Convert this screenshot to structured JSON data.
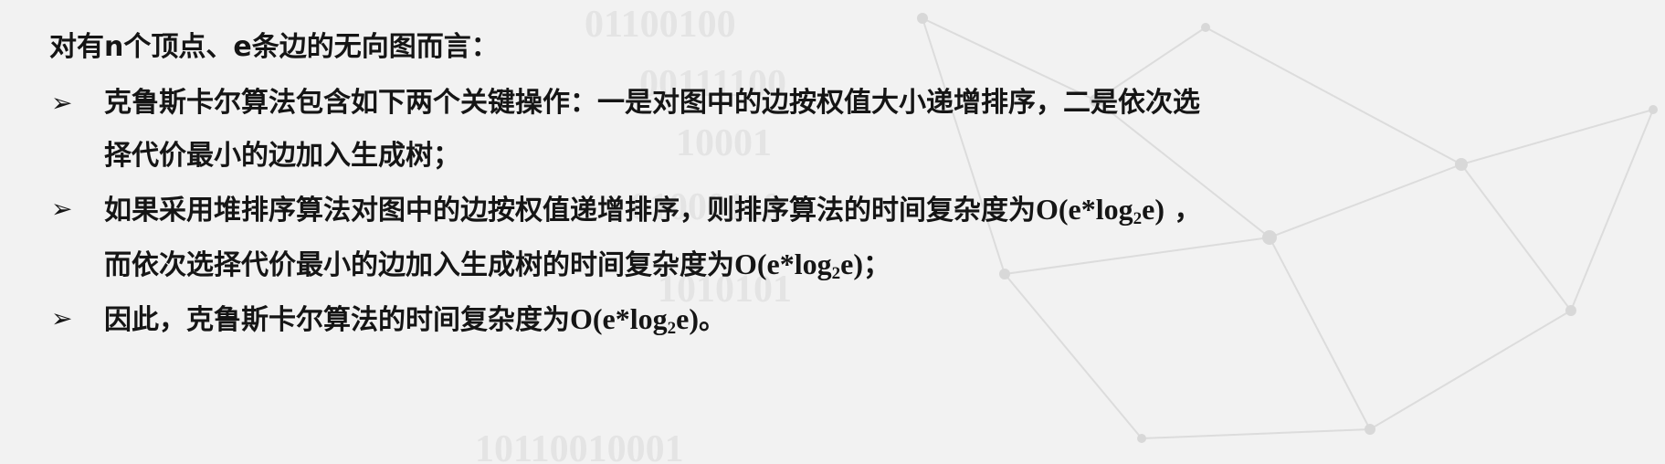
{
  "intro": "对有n个顶点、e条边的无向图而言：",
  "bullet_marker": "➢",
  "formula": {
    "prefix": "O(e*log",
    "sub": "2",
    "suffix": "e)"
  },
  "bullets": [
    {
      "line1": "克鲁斯卡尔算法包含如下两个关键操作：一是对图中的边按权值大小递增排序，二是依次选",
      "line2": "择代价最小的边加入生成树；"
    },
    {
      "line1_text": "如果采用堆排序算法对图中的边按权值递增排序，则排序算法的时间复杂度为",
      "line1_tail": " ，",
      "line2_text": "而依次选择代价最小的边加入生成树的时间复杂度为",
      "line2_tail": "；"
    },
    {
      "line1_text": "因此，克鲁斯卡尔算法的时间复杂度为",
      "line1_tail": "。"
    }
  ],
  "background_watermark_digits": [
    "01100100",
    "00111100",
    "10001",
    "01000110",
    "1010101",
    "10110010001"
  ]
}
